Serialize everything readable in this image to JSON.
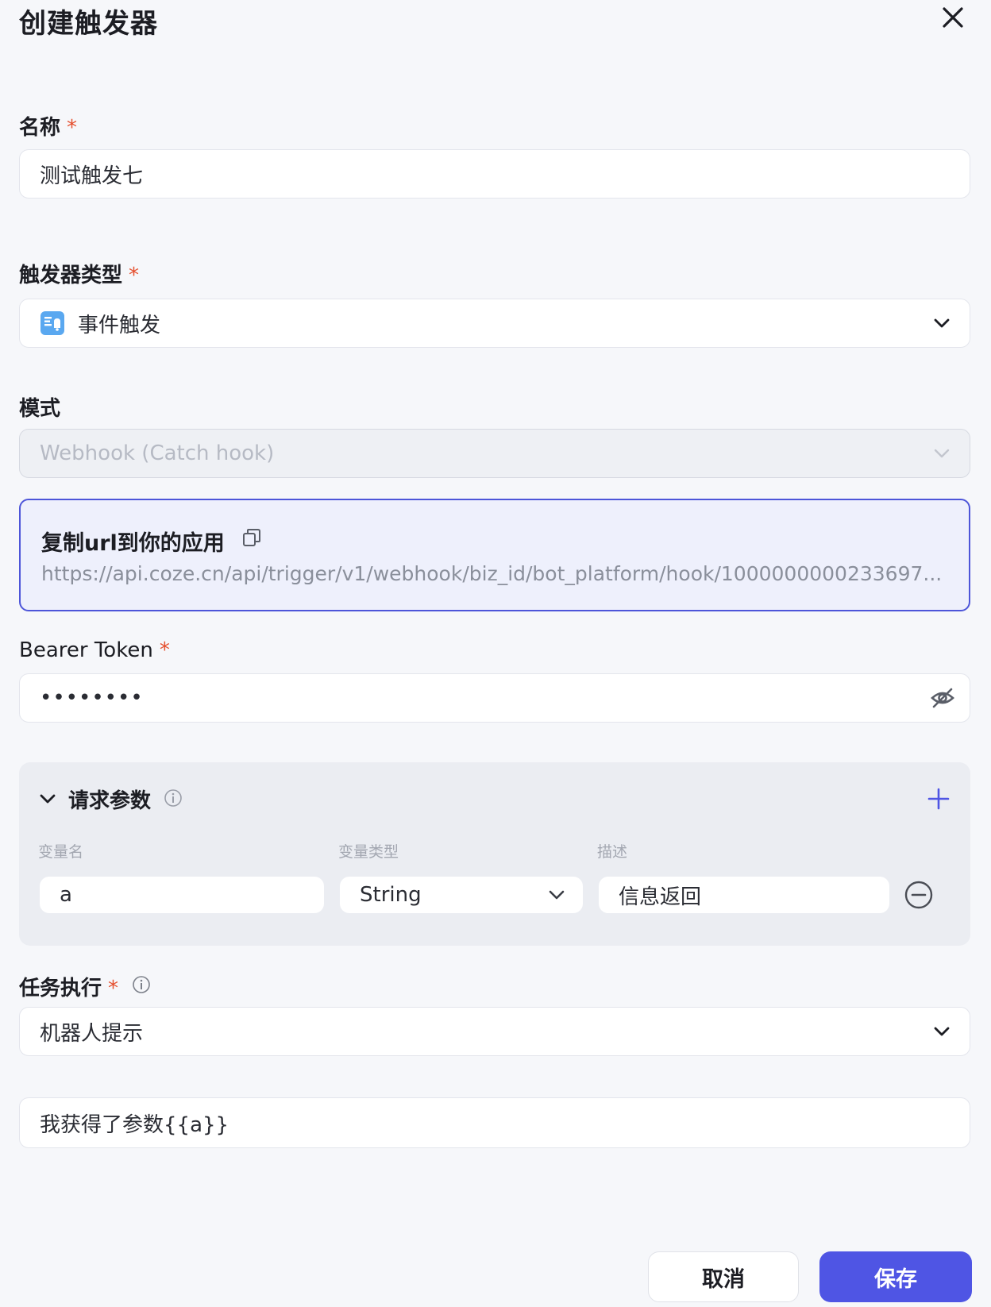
{
  "dialog": {
    "title": "创建触发器",
    "close_icon": "close-icon"
  },
  "name_field": {
    "label": "名称",
    "required_mark": "*",
    "value": "测试触发七"
  },
  "trigger_type": {
    "label": "触发器类型",
    "required_mark": "*",
    "icon": "event-trigger-icon",
    "value": "事件触发"
  },
  "mode": {
    "label": "模式",
    "value": "Webhook (Catch hook)",
    "disabled": true
  },
  "webhook_url": {
    "title": "复制url到你的应用",
    "url": "https://api.coze.cn/api/trigger/v1/webhook/biz_id/bot_platform/hook/1000000000233697..."
  },
  "bearer_token": {
    "label": "Bearer Token",
    "required_mark": "*",
    "value": "••••••••"
  },
  "request_params": {
    "title": "请求参数",
    "columns": [
      "变量名",
      "变量类型",
      "描述"
    ],
    "rows": [
      {
        "name": "a",
        "type": "String",
        "description": "信息返回"
      }
    ]
  },
  "task_execution": {
    "label": "任务执行",
    "required_mark": "*",
    "value": "机器人提示"
  },
  "prompt": {
    "value": "我获得了参数{{a}}"
  },
  "footer": {
    "cancel_label": "取消",
    "save_label": "保存"
  },
  "colors": {
    "accent": "#4f55e4",
    "required": "#e5502f",
    "url_box_bg": "#eef0fc",
    "page_bg": "#f6f7fa"
  }
}
